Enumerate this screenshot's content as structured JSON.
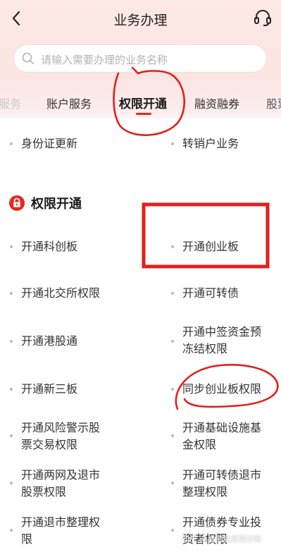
{
  "header": {
    "title": "业务办理",
    "back_icon": "chevron-left-icon",
    "support_icon": "headset-icon"
  },
  "search": {
    "placeholder": "请输入需要办理的业务名称"
  },
  "tabs": [
    {
      "label": "服务",
      "state": "faded"
    },
    {
      "label": "账户服务",
      "state": "normal"
    },
    {
      "label": "权限开通",
      "state": "active"
    },
    {
      "label": "融资融券",
      "state": "normal"
    },
    {
      "label": "股票",
      "state": "faded"
    }
  ],
  "top_items": [
    {
      "label": "身份证更新"
    },
    {
      "label": "转销户业务"
    }
  ],
  "section": {
    "title": "权限开通",
    "icon": "lock-icon"
  },
  "items": {
    "kcb": "开通科创板",
    "cyb": "开通创业板",
    "bjs": "开通北交所权限",
    "kzz": "开通可转债",
    "ggt": "开通港股通",
    "zqzj_1": "开通中签资金预",
    "zqzj_2": "冻结权限",
    "xsb": "开通新三板",
    "tbcyb": "同步创业板权限",
    "fxjs_1": "开通风险警示股",
    "fxjs_2": "票交易权限",
    "jcss_1": "开通基础设施基",
    "jcss_2": "金权限",
    "lwts_1": "开通两网及退市",
    "lwts_2": "股票权限",
    "kzzts_1": "开通可转债退市",
    "kzzts_2": "整理权限",
    "tszl_1": "开通退市整理权",
    "tszl_2": "限",
    "zqzy_1": "开通债券专业投",
    "zqzy_2": "资者权限"
  },
  "watermark": "知乎 @投资就是算好账",
  "colors": {
    "accent": "#e8281e",
    "annotation": "#e0201c",
    "background_top": "#fde9e6"
  }
}
